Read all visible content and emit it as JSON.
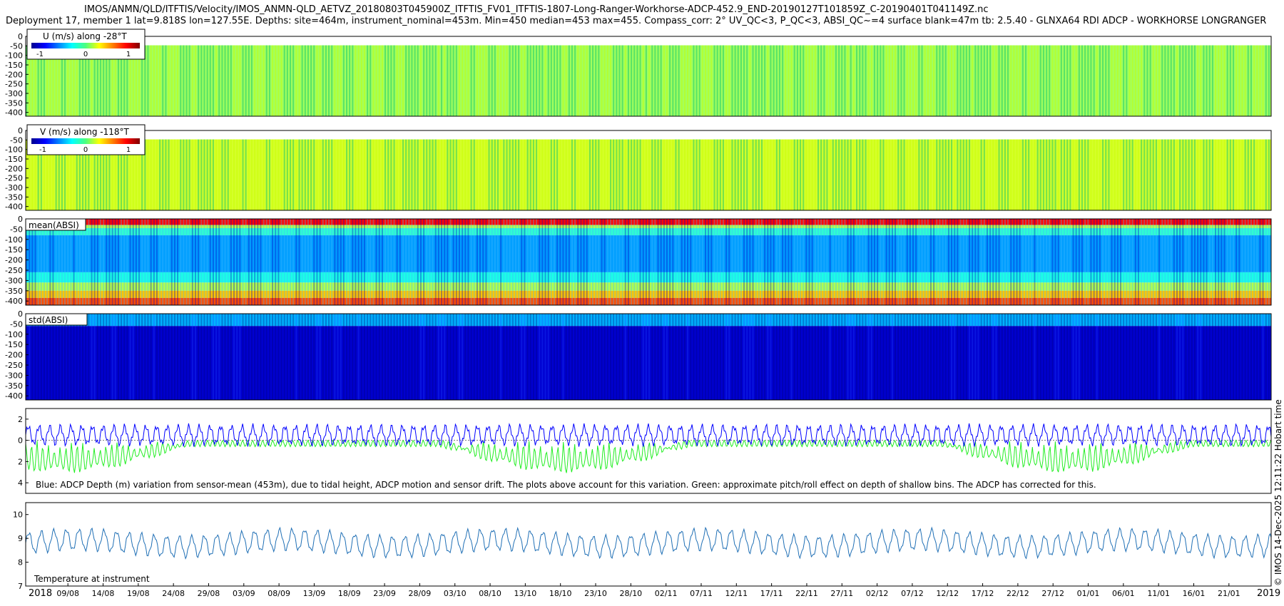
{
  "header": {
    "file_path": "IMOS/ANMN/QLD/ITFTIS/Velocity/IMOS_ANMN-QLD_AETVZ_20180803T045900Z_ITFTIS_FV01_ITFTIS-1807-Long-Ranger-Workhorse-ADCP-452.9_END-20190127T101859Z_C-20190401T041149Z.nc",
    "deployment_info": "Deployment 17, member 1 lat=9.818S lon=127.55E. Depths: site=464m, instrument_nominal=453m. Min=450 median=453 max=455. Compass_corr: 2° UV_QC<3, P_QC<3, ABSI_QC~=4 surface blank=47m tb: 2.5.40 - GLNXA64 RDI ADCP - WORKHORSE LONGRANGER"
  },
  "side_label": "© IMOS 14-Dec-2025 12:11:22 Hobart time",
  "colors": {
    "jet_low": "#00008f",
    "jet_mid": "#4cff80",
    "jet_high": "#800000",
    "depth_series": "#0000ff",
    "pitchroll_series": "#22ee22",
    "temperature_series": "#1f6fb5"
  },
  "chart_data": [
    {
      "type": "heatmap",
      "panel": "u-velocity",
      "title": "U (m/s) along -28°T",
      "colorbar_ticks": [
        "-1",
        "0",
        "1"
      ],
      "yticks": [
        "0",
        "-50",
        "-100",
        "-150",
        "-200",
        "-250",
        "-300",
        "-350",
        "-400"
      ],
      "depth_range": [
        0,
        420
      ],
      "value_range": [
        -1.5,
        1.5
      ],
      "surface_blank_m": 47,
      "depth_bands": [
        {
          "depth": [
            0,
            47
          ],
          "value": null
        },
        {
          "depth": [
            47,
            420
          ],
          "value": 0.1
        }
      ]
    },
    {
      "type": "heatmap",
      "panel": "v-velocity",
      "title": "V (m/s) along -118°T",
      "colorbar_ticks": [
        "-1",
        "0",
        "1"
      ],
      "yticks": [
        "0",
        "-50",
        "-100",
        "-150",
        "-200",
        "-250",
        "-300",
        "-350",
        "-400"
      ],
      "depth_range": [
        0,
        420
      ],
      "value_range": [
        -1.5,
        1.5
      ],
      "surface_blank_m": 47,
      "depth_bands": [
        {
          "depth": [
            0,
            47
          ],
          "value": null
        },
        {
          "depth": [
            47,
            420
          ],
          "value": 0.25
        }
      ]
    },
    {
      "type": "heatmap",
      "panel": "mean-absi",
      "title": "mean(ABSI)",
      "yticks": [
        "0",
        "-50",
        "-100",
        "-150",
        "-200",
        "-250",
        "-300",
        "-350",
        "-400"
      ],
      "depth_range": [
        0,
        420
      ],
      "value_range": [
        0,
        1
      ],
      "depth_bands": [
        {
          "depth": [
            0,
            30
          ],
          "value": 0.87
        },
        {
          "depth": [
            30,
            45
          ],
          "value": 0.55
        },
        {
          "depth": [
            45,
            80
          ],
          "value": 0.42
        },
        {
          "depth": [
            80,
            260
          ],
          "value": 0.28
        },
        {
          "depth": [
            260,
            310
          ],
          "value": 0.4
        },
        {
          "depth": [
            310,
            350
          ],
          "value": 0.55
        },
        {
          "depth": [
            350,
            385
          ],
          "value": 0.68
        },
        {
          "depth": [
            385,
            420
          ],
          "value": 0.8
        }
      ]
    },
    {
      "type": "heatmap",
      "panel": "std-absi",
      "title": "std(ABSI)",
      "yticks": [
        "0",
        "-50",
        "-100",
        "-150",
        "-200",
        "-250",
        "-300",
        "-350",
        "-400"
      ],
      "depth_range": [
        0,
        420
      ],
      "value_range": [
        0,
        1
      ],
      "depth_bands": [
        {
          "depth": [
            0,
            60
          ],
          "value": 0.3
        },
        {
          "depth": [
            60,
            420
          ],
          "value": 0.08
        }
      ]
    },
    {
      "type": "line",
      "panel": "depth-variation",
      "annotation": "Blue: ADCP Depth (m) variation from sensor-mean (453m), due to tidal height, ADCP motion and sensor drift. The plots above account for this variation. Green: approximate pitch/roll effect on depth of shallow bins. The ADCP has corrected for this.",
      "yticks": [
        "2",
        "0",
        "2",
        "4"
      ],
      "ylim": [
        -5,
        3
      ],
      "series": [
        {
          "role": "depth-variation",
          "color": "#0000ff",
          "mean": 0.5,
          "amplitude": 1.0
        },
        {
          "role": "pitch-roll-effect",
          "color": "#22ee22",
          "mean": -0.3,
          "amplitude": 2.5
        }
      ]
    },
    {
      "type": "line",
      "panel": "temperature",
      "annotation": "Temperature at instrument",
      "yticks": [
        "7",
        "8",
        "9",
        "10"
      ],
      "ylim": [
        7,
        10.5
      ],
      "series": [
        {
          "role": "temperature",
          "color": "#1f6fb5",
          "mean": 8.8,
          "amplitude": 0.6
        }
      ]
    }
  ],
  "x_axis": {
    "year_start": "2018",
    "year_end": "2019",
    "date_range": [
      "2018-08-03",
      "2019-01-27"
    ],
    "ticks": [
      "09/08",
      "14/08",
      "19/08",
      "24/08",
      "29/08",
      "03/09",
      "08/09",
      "13/09",
      "18/09",
      "23/09",
      "28/09",
      "03/10",
      "08/10",
      "13/10",
      "18/10",
      "23/10",
      "28/10",
      "02/11",
      "07/11",
      "12/11",
      "17/11",
      "22/11",
      "27/11",
      "02/12",
      "07/12",
      "12/12",
      "17/12",
      "22/12",
      "27/12",
      "01/01",
      "06/01",
      "11/01",
      "16/01",
      "21/01"
    ]
  }
}
